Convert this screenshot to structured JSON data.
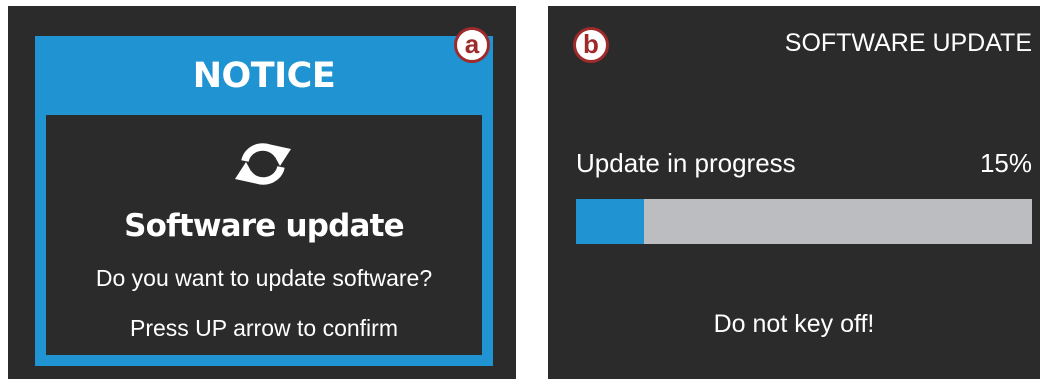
{
  "panel_a": {
    "callout": "a",
    "notice_title": "NOTICE",
    "icon": "refresh-icon",
    "heading": "Software update",
    "question": "Do you want to update software?",
    "hint": "Press UP arrow to confirm"
  },
  "panel_b": {
    "callout": "b",
    "screen_title": "SOFTWARE UPDATE",
    "progress_label": "Update in progress",
    "progress_percent_text": "15%",
    "progress_value": 0.15,
    "warning": "Do not key off!"
  },
  "colors": {
    "accent": "#2093d2",
    "screen_background": "#2b2b2b",
    "progress_track": "#bcbdc0",
    "callout": "#9e2a2b",
    "text": "#ffffff"
  }
}
